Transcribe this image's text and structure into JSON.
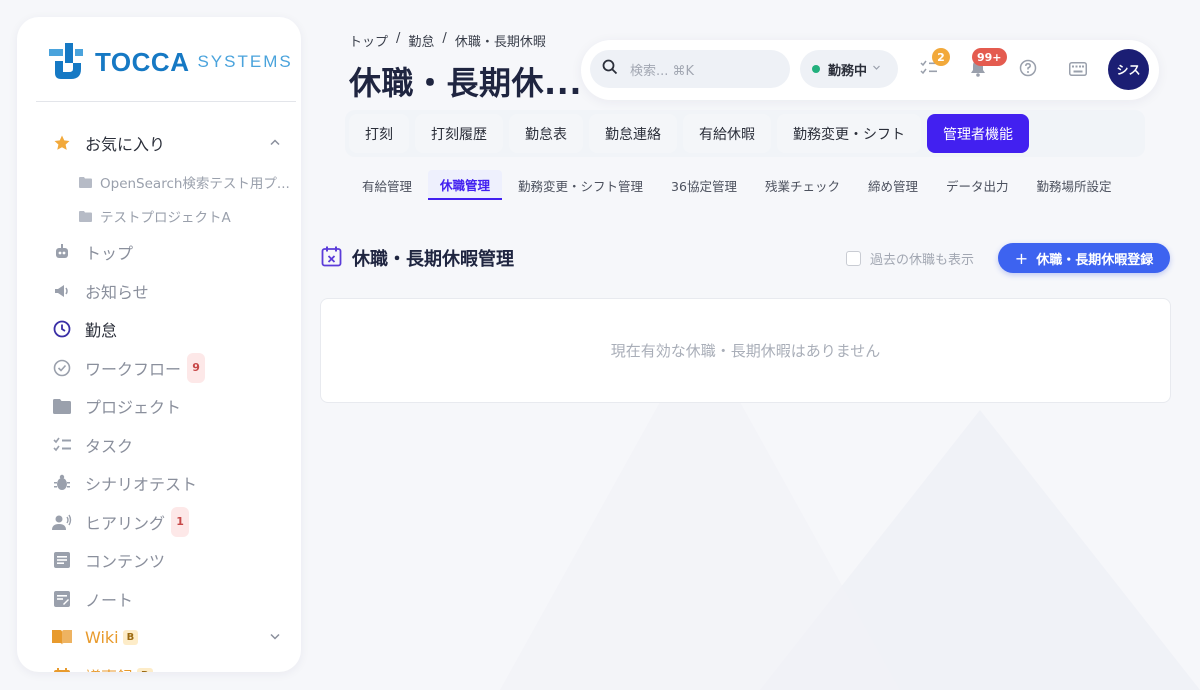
{
  "brand": {
    "name": "TOCCA",
    "sub": "SYSTEMS"
  },
  "sidebar": {
    "favorites": {
      "label": "お気に入り",
      "items": [
        {
          "label": "OpenSearch検索テスト用プ..."
        },
        {
          "label": "テストプロジェクトA"
        }
      ]
    },
    "items": [
      {
        "label": "トップ",
        "icon": "robot-icon"
      },
      {
        "label": "お知らせ",
        "icon": "megaphone-icon"
      },
      {
        "label": "勤怠",
        "icon": "clock-icon"
      },
      {
        "label": "ワークフロー",
        "icon": "check-circle-icon",
        "badge": "9"
      },
      {
        "label": "プロジェクト",
        "icon": "folder-icon"
      },
      {
        "label": "タスク",
        "icon": "checklist-icon"
      },
      {
        "label": "シナリオテスト",
        "icon": "bug-icon"
      },
      {
        "label": "ヒアリング",
        "icon": "voice-icon",
        "badge": "1"
      },
      {
        "label": "コンテンツ",
        "icon": "document-icon"
      },
      {
        "label": "ノート",
        "icon": "note-icon"
      },
      {
        "label": "Wiki",
        "icon": "book-icon",
        "beta": "B"
      },
      {
        "label": "議事録",
        "icon": "calendar-icon",
        "beta": "B"
      }
    ]
  },
  "breadcrumb": {
    "items": [
      "トップ",
      "勤怠",
      "休職・長期休暇"
    ],
    "sep": "/"
  },
  "page_title": "休職・長期休...",
  "topbar": {
    "search_placeholder": "検索... ⌘K",
    "status": "勤務中",
    "tasks_badge": "2",
    "notifications_badge": "99+",
    "avatar": "シス"
  },
  "tabs": [
    "打刻",
    "打刻履歴",
    "勤怠表",
    "勤怠連絡",
    "有給休暇",
    "勤務変更・シフト",
    "管理者機能"
  ],
  "subtabs": [
    "有給管理",
    "休職管理",
    "勤務変更・シフト管理",
    "36協定管理",
    "残業チェック",
    "締め管理",
    "データ出力",
    "勤務場所設定"
  ],
  "section": {
    "title": "休職・長期休暇管理",
    "past_checkbox": "過去の休職も表示",
    "add_button": "休職・長期休暇登録",
    "empty_message": "現在有効な休職・長期休暇はありません"
  },
  "colors": {
    "accent": "#4220f0",
    "primary_button": "#3d63f0",
    "brand": "#1679c4",
    "status_dot": "#22b07d"
  }
}
